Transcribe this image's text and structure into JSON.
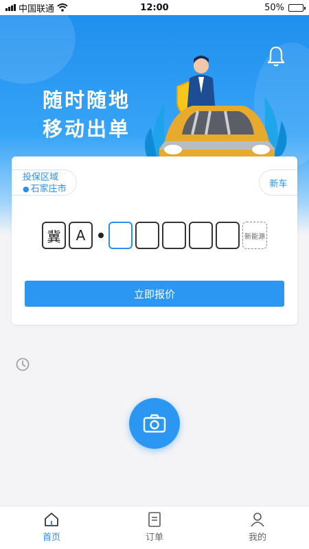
{
  "status_bar": {
    "carrier": "中国联通",
    "time": "12:00",
    "battery": "50%",
    "battery_level": 0.5
  },
  "banner": {
    "line1": "随时随地",
    "line2": "移动出单"
  },
  "card": {
    "region_label": "投保区域",
    "region_city": "石家庄市",
    "new_car_label": "新车",
    "plate": {
      "province": "冀",
      "letter": "A",
      "nev_label": "新能源"
    },
    "quote_button": "立即报价"
  },
  "tabs": [
    {
      "label": "首页",
      "icon": "home-icon"
    },
    {
      "label": "订单",
      "icon": "document-icon"
    },
    {
      "label": "我的",
      "icon": "user-icon"
    }
  ],
  "colors": {
    "accent": "#2c97f2",
    "banner_top": "#1f8fee",
    "background": "#f4f4f6"
  }
}
